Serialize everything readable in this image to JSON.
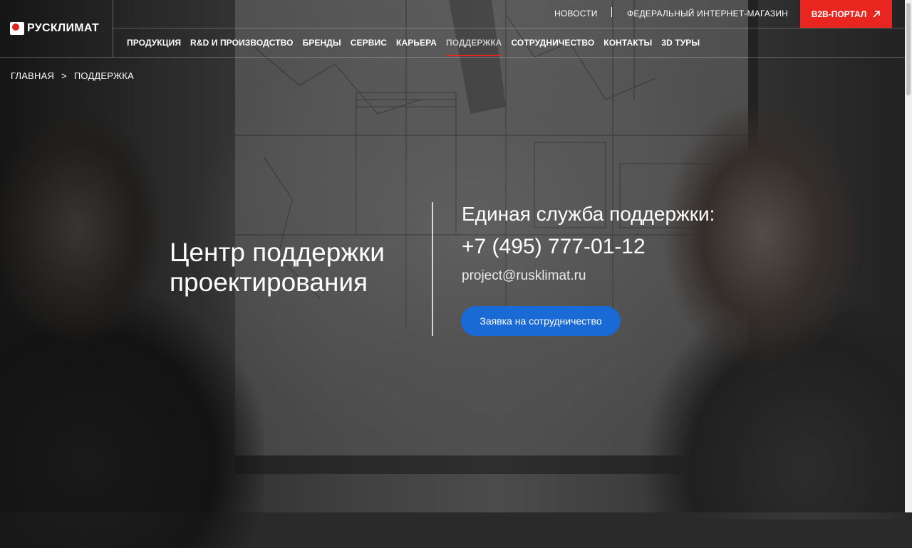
{
  "header": {
    "logo_text": "РУСКЛИМАТ",
    "top_links": [
      "НОВОСТИ",
      "ФЕДЕРАЛЬНЫЙ ИНТЕРНЕТ-МАГАЗИН"
    ],
    "b2b_label": "B2B-ПОРТАЛ",
    "accent_color": "#e8251f"
  },
  "nav": {
    "items": [
      "ПРОДУКЦИЯ",
      "R&D И ПРОИЗВОДСТВО",
      "БРЕНДЫ",
      "СЕРВИС",
      "КАРЬЕРА",
      "ПОДДЕРЖКА",
      "СОТРУДНИЧЕСТВО",
      "КОНТАКТЫ",
      "3D ТУРЫ"
    ],
    "active_item": "ПОДДЕРЖКА"
  },
  "breadcrumb": {
    "home": "ГЛАВНАЯ",
    "separator": ">",
    "current": "ПОДДЕРЖКА"
  },
  "hero": {
    "title_line1": "Центр поддержки",
    "title_line2": "проектирования",
    "support_title": "Единая служба поддержки:",
    "phone": "+7 (495) 777-01-12",
    "email": "project@rusklimat.ru",
    "cta_label": "Заявка на сотрудничество",
    "cta_color": "#1a6ad6"
  }
}
